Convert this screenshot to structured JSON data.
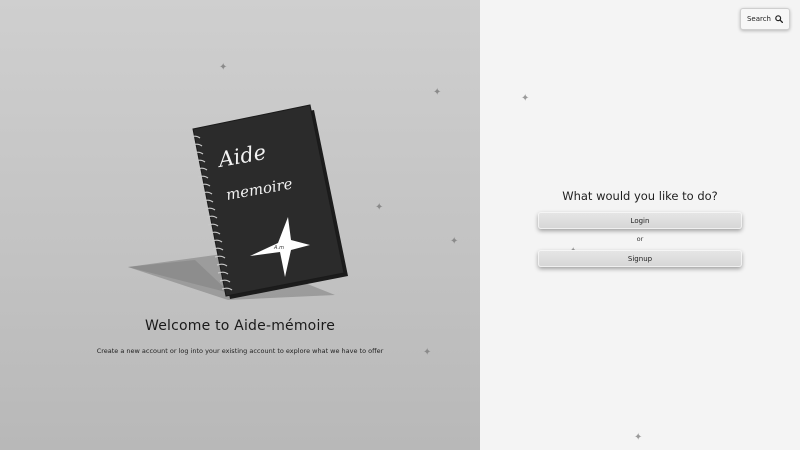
{
  "left": {
    "title": "Welcome to Aide-mémoire",
    "subtitle": "Create a new account or log into your existing account to explore what we have to offer",
    "notebook": {
      "line1": "Aide",
      "line2": "memoire",
      "star_label": "A.m"
    }
  },
  "header": {
    "search_label": "Search"
  },
  "right": {
    "question": "What would you like to do?",
    "login_label": "Login",
    "or_label": "or",
    "signup_label": "Signup"
  },
  "icons": {
    "search": "magnifier-icon",
    "sparkle": "four-point-star-icon"
  },
  "colors": {
    "left_bg": "#c4c4c4",
    "right_bg": "#f4f4f4",
    "notebook_cover": "#2b2b2b",
    "button_bg": "#dedede"
  }
}
